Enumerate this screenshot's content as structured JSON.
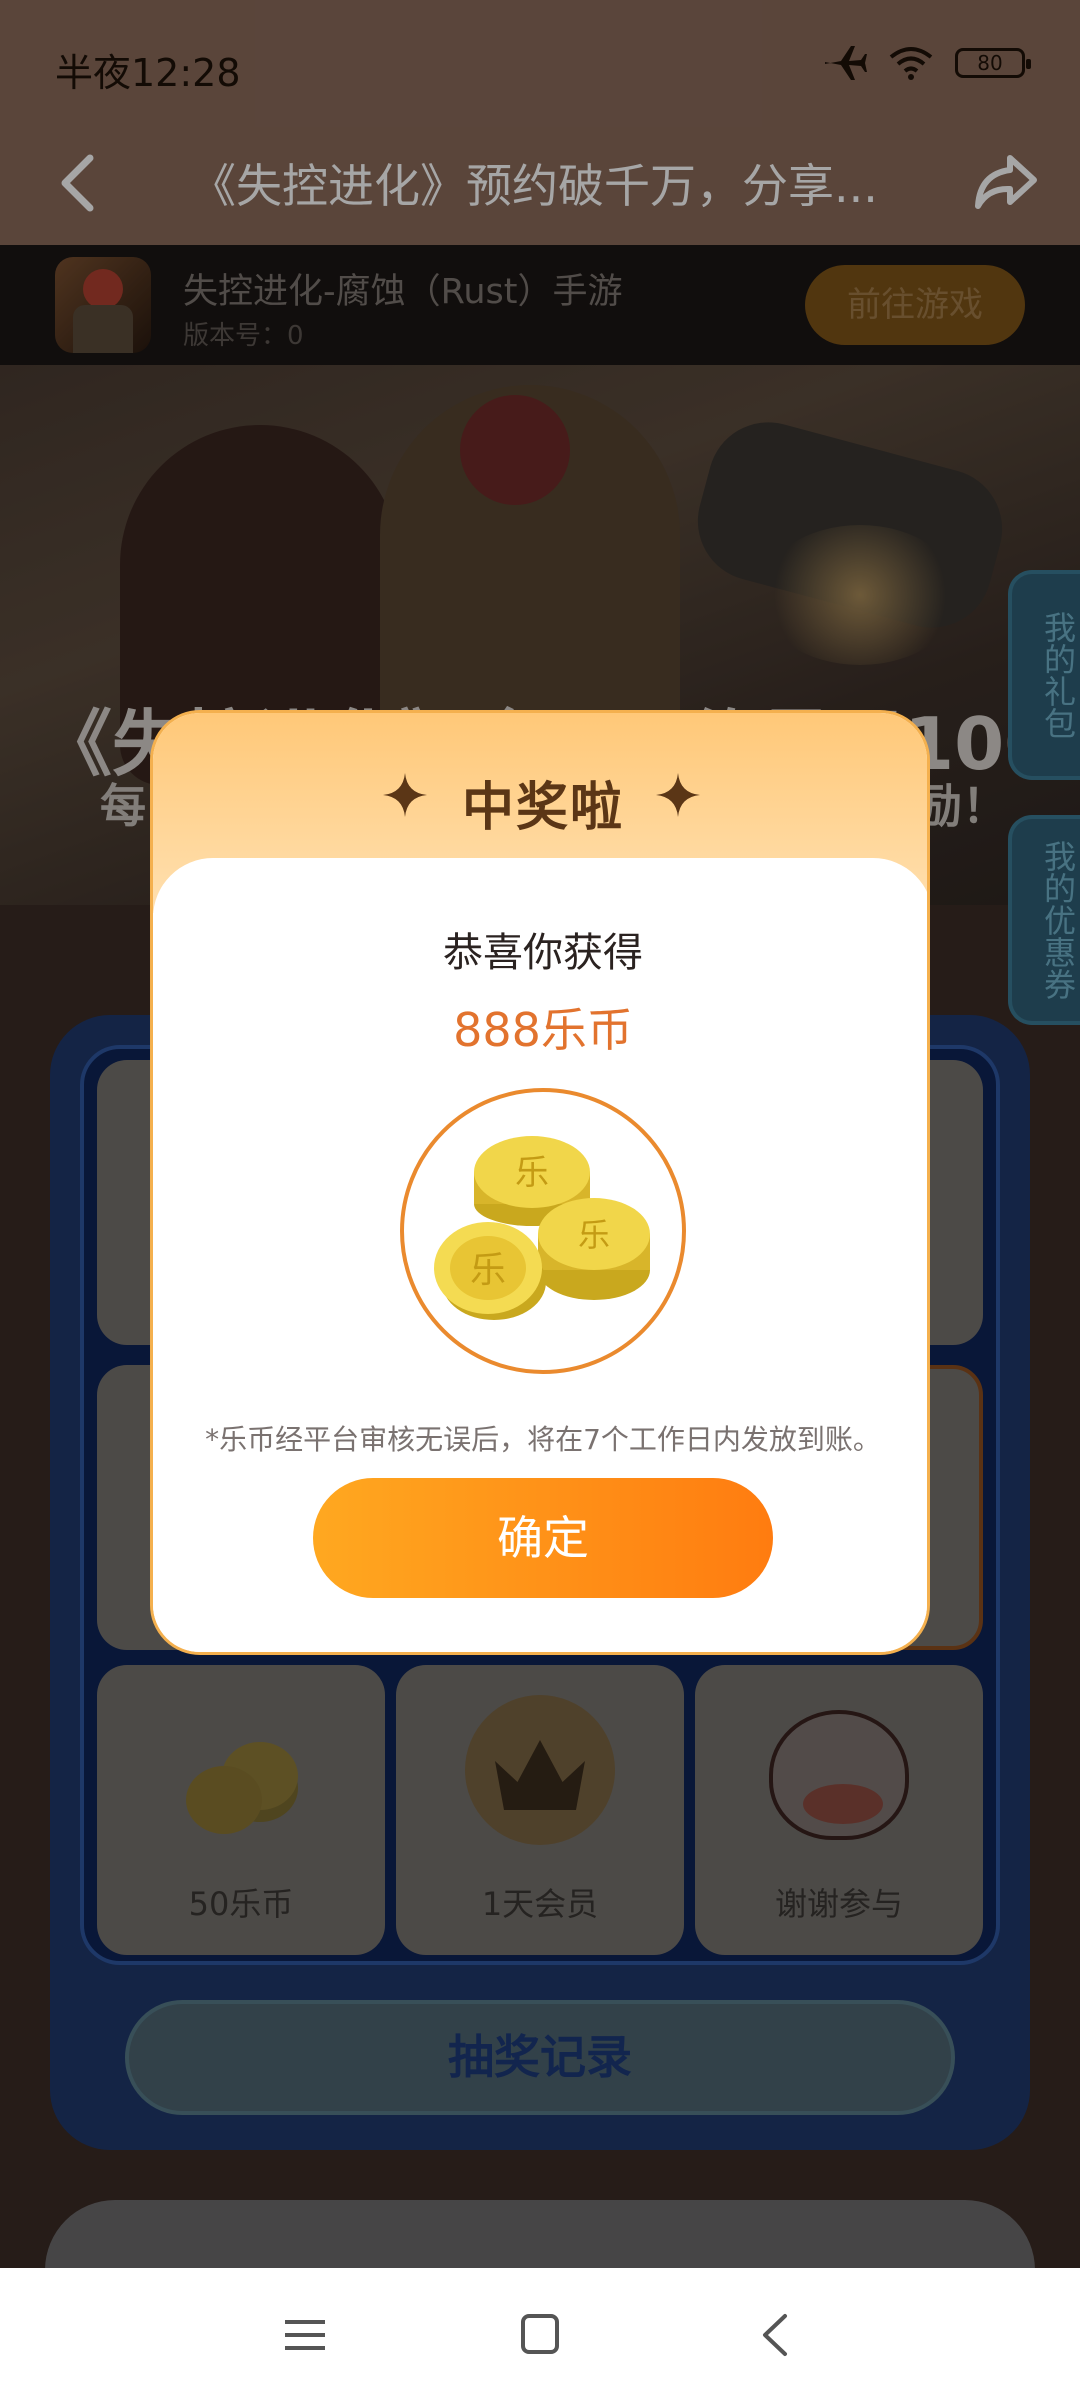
{
  "status": {
    "time": "半夜12:28",
    "battery": "80"
  },
  "nav": {
    "title": "《失控进化》预约破千万，分享..."
  },
  "game": {
    "name": "失控进化-腐蚀（Rust）手游",
    "version": "版本号：0",
    "go_label": "前往游戏"
  },
  "banner": {
    "headline": "《失控进化》全民预约最强1000万",
    "sub_left": "每",
    "sub_right": "奖励！"
  },
  "side_tabs": {
    "gift": "我的礼包",
    "coupon": "我的优惠券"
  },
  "lottery": {
    "cells": [
      {
        "label": "50乐币"
      },
      {
        "label": "1天会员"
      },
      {
        "label": "谢谢参与"
      }
    ],
    "record_label": "抽奖记录"
  },
  "lower_card": {
    "title": ""
  },
  "modal": {
    "title": "中奖啦",
    "congrats": "恭喜你获得",
    "prize": "888乐币",
    "coin_glyph": "乐",
    "note": "*乐币经平台审核无误后，将在7个工作日内发放到账。",
    "confirm_label": "确定"
  },
  "colors": {
    "accent": "#FF8C1A",
    "prize": "#E2732E",
    "header": "#8A6A5A"
  }
}
